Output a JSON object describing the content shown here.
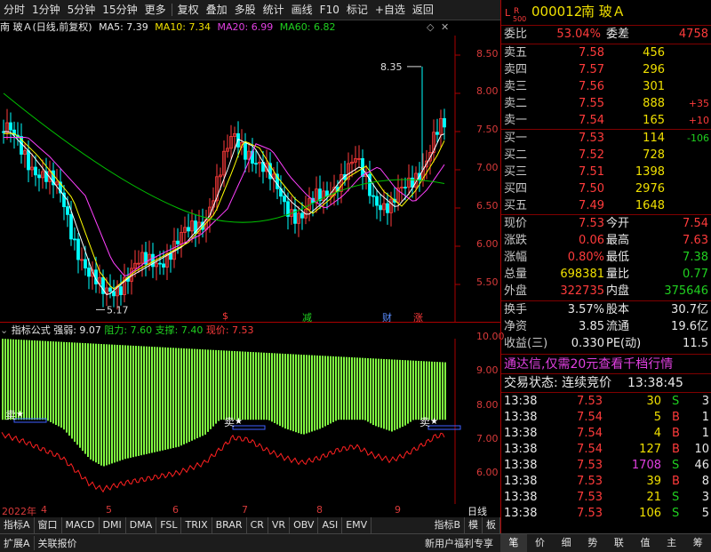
{
  "toolbar": {
    "items": [
      "分时",
      "1分钟",
      "5分钟",
      "15分钟",
      "更多",
      "复权",
      "叠加",
      "多股",
      "统计",
      "画线",
      "F10",
      "标记",
      "+自选",
      "返回"
    ]
  },
  "chart_header": {
    "title": "南 玻Ａ(日线,前复权)",
    "ma5": "MA5: 7.39",
    "ma10": "MA10: 7.34",
    "ma20": "MA20: 6.99",
    "ma60": "MA60: 6.82"
  },
  "price_axis": [
    "8.50",
    "8.00",
    "7.50",
    "7.00",
    "6.50",
    "6.00",
    "5.50"
  ],
  "annotations": {
    "high": "8.35",
    "low": "5.17"
  },
  "event_marks": [
    {
      "text": "$",
      "color": "#ff3b3b"
    },
    {
      "text": "减",
      "color": "#20d020"
    },
    {
      "text": "财",
      "color": "#5a8cff"
    },
    {
      "text": "涨",
      "color": "#ff3b3b"
    }
  ],
  "indicator_header": {
    "name": "指标公式",
    "strength": "强弱: 9.07",
    "resistance": "阻力: 7.60",
    "support": "支撑: 7.40",
    "current": "现价: 7.53"
  },
  "ind_axis": [
    "10.00",
    "9.00",
    "8.00",
    "7.00",
    "6.00"
  ],
  "sell_labels": [
    "卖",
    "卖",
    "卖"
  ],
  "dates": [
    "2022年",
    "4",
    "5",
    "6",
    "7",
    "8",
    "9"
  ],
  "period_label": "日线",
  "indicator_tabs": [
    "指标A",
    "窗口",
    "MACD",
    "DMI",
    "DMA",
    "FSL",
    "TRIX",
    "BRAR",
    "CR",
    "VR",
    "OBV",
    "ASI",
    "EMV",
    "指标B",
    "模",
    "板"
  ],
  "bottom_bar": {
    "left1": "扩展A",
    "left2": "关联报价",
    "promo": "新用户福利专享",
    "tabs": [
      "笔",
      "价",
      "细",
      "势",
      "联",
      "值",
      "主",
      "筹"
    ]
  },
  "quote": {
    "code": "000012",
    "name": "南 玻Ａ",
    "badge_l": "L",
    "badge_r": "R",
    "badge_n": "500",
    "weibi_label": "委比",
    "weibi": "53.04%",
    "weicha_label": "委差",
    "weicha": "4758",
    "asks": [
      {
        "label": "卖五",
        "price": "7.58",
        "vol": "456",
        "chg": ""
      },
      {
        "label": "卖四",
        "price": "7.57",
        "vol": "296",
        "chg": ""
      },
      {
        "label": "卖三",
        "price": "7.56",
        "vol": "301",
        "chg": ""
      },
      {
        "label": "卖二",
        "price": "7.55",
        "vol": "888",
        "chg": "+35"
      },
      {
        "label": "卖一",
        "price": "7.54",
        "vol": "165",
        "chg": "+10"
      }
    ],
    "bids": [
      {
        "label": "买一",
        "price": "7.53",
        "vol": "114",
        "chg": "-106"
      },
      {
        "label": "买二",
        "price": "7.52",
        "vol": "728",
        "chg": ""
      },
      {
        "label": "买三",
        "price": "7.51",
        "vol": "1398",
        "chg": ""
      },
      {
        "label": "买四",
        "price": "7.50",
        "vol": "2976",
        "chg": ""
      },
      {
        "label": "买五",
        "price": "7.49",
        "vol": "1648",
        "chg": ""
      }
    ],
    "stats": [
      {
        "l1": "现价",
        "v1": "7.53",
        "c1": "red",
        "l2": "今开",
        "v2": "7.54",
        "c2": "red"
      },
      {
        "l1": "涨跌",
        "v1": "0.06",
        "c1": "red",
        "l2": "最高",
        "v2": "7.63",
        "c2": "red"
      },
      {
        "l1": "涨幅",
        "v1": "0.80%",
        "c1": "red",
        "l2": "最低",
        "v2": "7.38",
        "c2": "grn"
      },
      {
        "l1": "总量",
        "v1": "698381",
        "c1": "yel",
        "l2": "量比",
        "v2": "0.77",
        "c2": "grn"
      },
      {
        "l1": "外盘",
        "v1": "322735",
        "c1": "red",
        "l2": "内盘",
        "v2": "375646",
        "c2": "grn"
      }
    ],
    "stats2": [
      {
        "l1": "换手",
        "v1": "3.57%",
        "l2": "股本",
        "v2": "30.7亿"
      },
      {
        "l1": "净资",
        "v1": "3.85",
        "l2": "流通",
        "v2": "19.6亿"
      },
      {
        "l1": "收益(三)",
        "v1": "0.330",
        "l2": "PE(动)",
        "v2": "11.5"
      }
    ],
    "promo": "通达信,仅需20元查看千档行情",
    "trade_status_label": "交易状态: 连续竞价",
    "trade_time": "13:38:45",
    "ticks": [
      {
        "t": "13:38",
        "p": "7.53",
        "v": "30",
        "s": "S",
        "n": "3",
        "vc": "yel"
      },
      {
        "t": "13:38",
        "p": "7.54",
        "v": "5",
        "s": "B",
        "n": "1",
        "vc": "yel"
      },
      {
        "t": "13:38",
        "p": "7.54",
        "v": "4",
        "s": "B",
        "n": "1",
        "vc": "yel"
      },
      {
        "t": "13:38",
        "p": "7.54",
        "v": "127",
        "s": "B",
        "n": "10",
        "vc": "yel"
      },
      {
        "t": "13:38",
        "p": "7.53",
        "v": "1708",
        "s": "S",
        "n": "46",
        "vc": "mag"
      },
      {
        "t": "13:38",
        "p": "7.53",
        "v": "39",
        "s": "B",
        "n": "8",
        "vc": "yel"
      },
      {
        "t": "13:38",
        "p": "7.53",
        "v": "21",
        "s": "S",
        "n": "3",
        "vc": "yel"
      },
      {
        "t": "13:38",
        "p": "7.53",
        "v": "106",
        "s": "S",
        "n": "5",
        "vc": "yel"
      }
    ]
  },
  "colors": {
    "up": "#ff3b3b",
    "down": "#00ffff",
    "ma5": "#ffffff",
    "ma10": "#ffff00",
    "ma20": "#ff40ff",
    "ma60": "#00c000",
    "bars": "#80ff40"
  }
}
